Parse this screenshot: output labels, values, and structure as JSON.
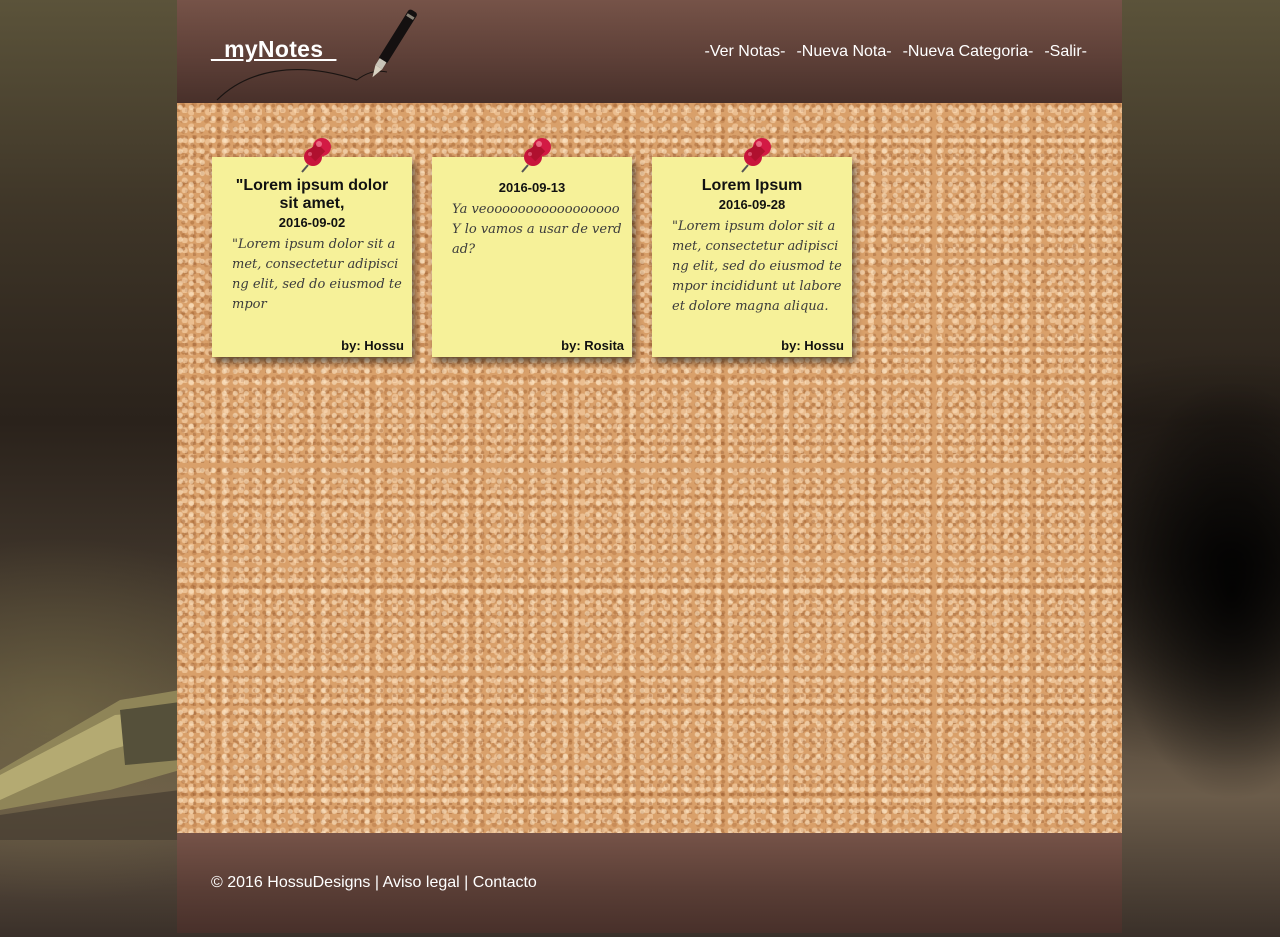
{
  "header": {
    "logo": "_myNotes_",
    "nav": [
      {
        "label": "-Ver Notas-"
      },
      {
        "label": "-Nueva Nota-"
      },
      {
        "label": "-Nueva Categoria-"
      },
      {
        "label": "-Salir-"
      }
    ]
  },
  "notes": [
    {
      "title": "\"Lorem ipsum dolor sit amet,",
      "date": "2016-09-02",
      "body": "\"Lorem ipsum dolor sit amet, consectetur adipiscing elit, sed do eiusmod tempor",
      "author": "by: Hossu",
      "icon": "pushpin-icon"
    },
    {
      "date": "2016-09-13",
      "body": "Ya veooooooooooooooooo Y lo vamos a usar de verdad?",
      "author": "by: Rosita",
      "icon": "pushpin-icon"
    },
    {
      "title": "Lorem Ipsum",
      "date": "2016-09-28",
      "body": "\"Lorem ipsum dolor sit amet, consectetur adipiscing elit, sed do eiusmod tempor incididunt ut labore et dolore magna aliqua.",
      "author": "by: Hossu",
      "icon": "pushpin-icon"
    }
  ],
  "footer": {
    "copyright": "© 2016 HossuDesigns",
    "separator": "|",
    "links": [
      {
        "label": "Aviso legal"
      },
      {
        "label": "Contacto"
      }
    ]
  },
  "colors": {
    "header": "#5e4038",
    "note": "#f6f199",
    "cork": "#d9a06a",
    "pin": "#c8143c"
  }
}
